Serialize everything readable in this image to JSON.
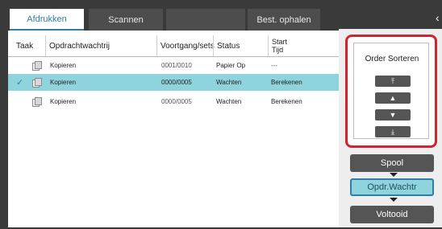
{
  "tabs": {
    "print": "Afdrukken",
    "scan": "Scannen",
    "fetch": "Best. ophalen"
  },
  "table": {
    "headers": {
      "taak": "Taak",
      "opdracht": "Opdrachtwachtrij",
      "voortgang": "Voortgang/sets",
      "status": "Status",
      "start_line1": "Start",
      "start_line2": "Tijd"
    },
    "rows": [
      {
        "name": "Kopieren",
        "progress": "0001/0010",
        "status": "Papier Op",
        "start": "---",
        "selected": false
      },
      {
        "name": "Kopieren",
        "progress": "0000/0005",
        "status": "Wachten",
        "start": "Berekenen",
        "selected": true
      },
      {
        "name": "Kopieren",
        "progress": "0000/0005",
        "status": "Wachten",
        "start": "Berekenen",
        "selected": false
      }
    ]
  },
  "order": {
    "title": "Order Sorteren",
    "buttons": {
      "top": "⤒",
      "up": "▲",
      "down": "▼",
      "bottom": "⤓"
    }
  },
  "nav": {
    "spool": "Spool",
    "queue": "Opdr.Wachtr",
    "done": "Voltooid"
  },
  "colors": {
    "accent": "#2d7ea8",
    "selected_row": "#8fd4dc",
    "highlight_border": "#d4232e",
    "dark_button": "#555555"
  }
}
